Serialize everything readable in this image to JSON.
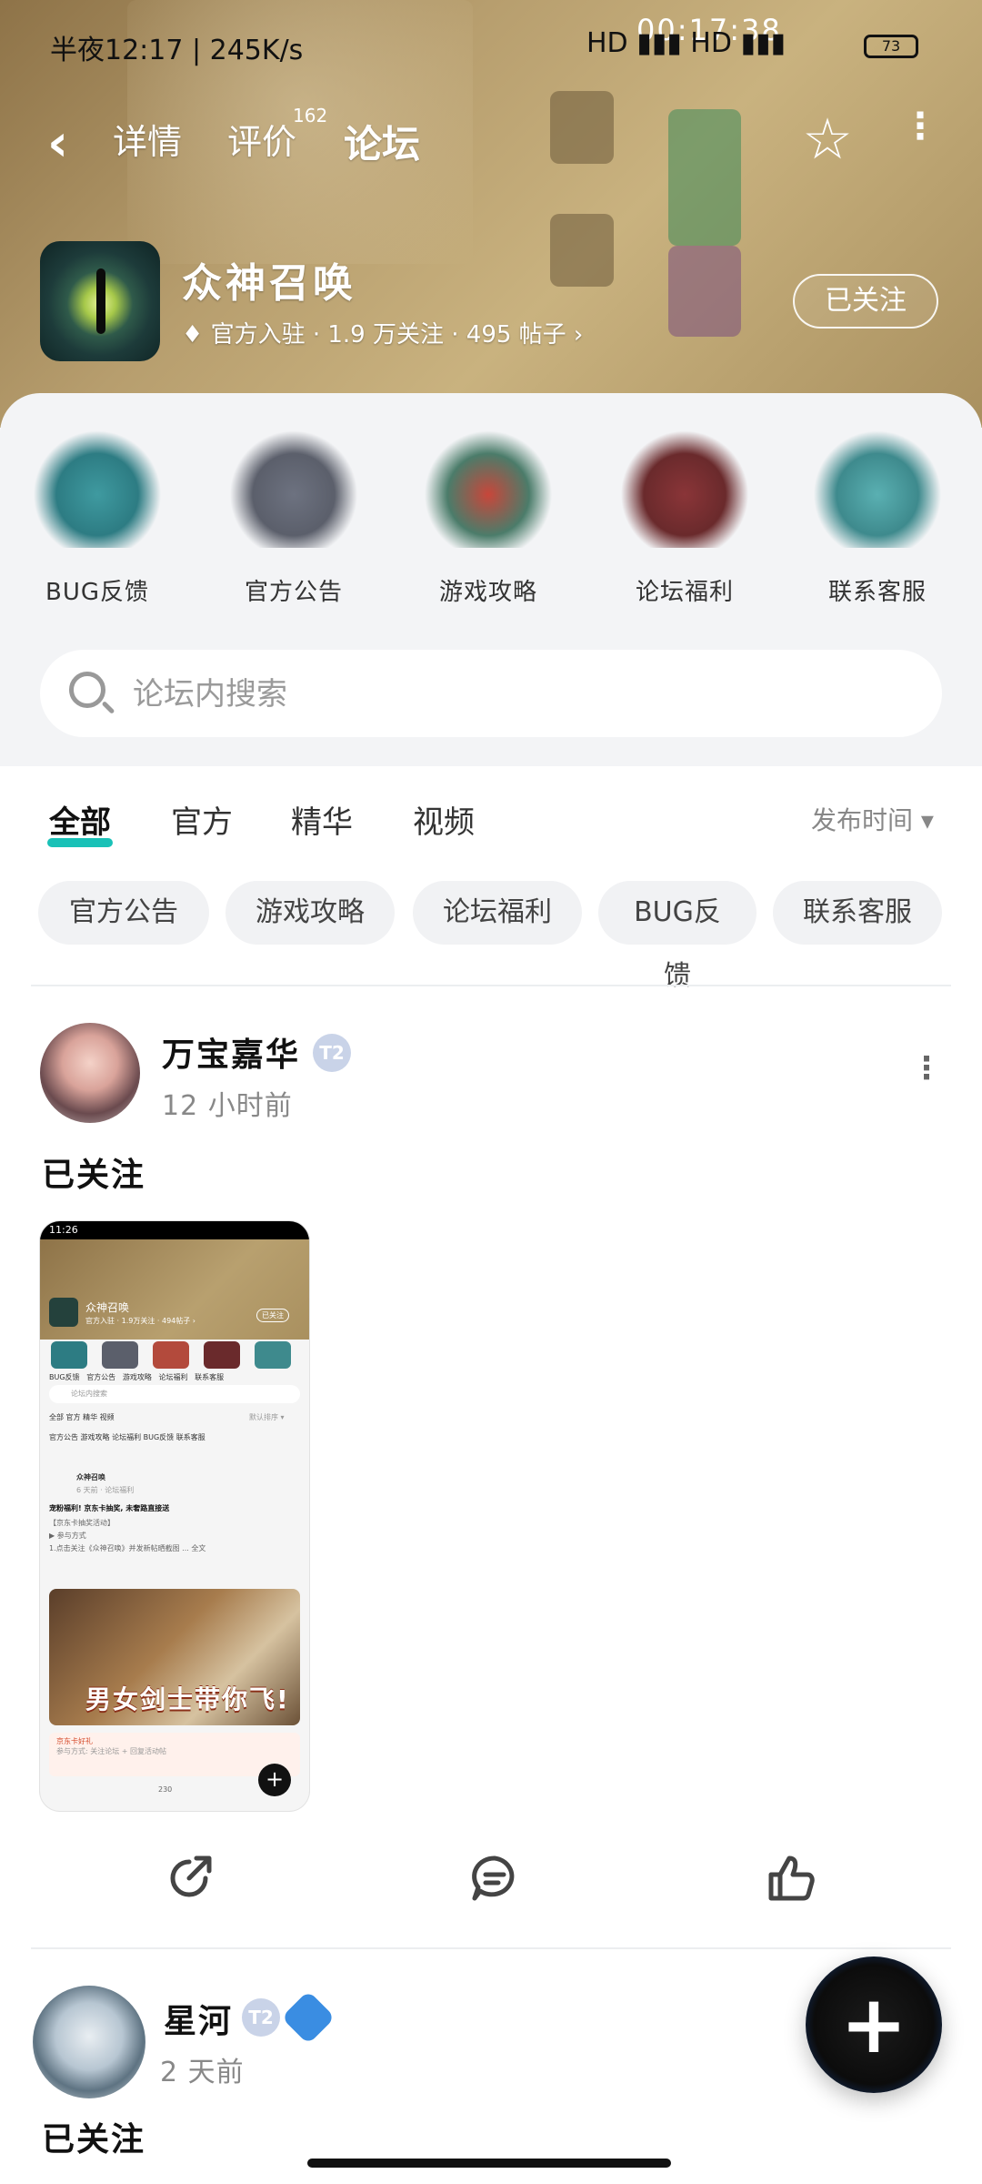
{
  "status_bar": {
    "left_text": "半夜12:17 | 245K/s",
    "time": "00:17:38",
    "network": "HD ▮▮▮ HD ▮▮▮",
    "battery": "73"
  },
  "top_nav": {
    "back_label": "‹",
    "tabs": [
      {
        "label": "详情"
      },
      {
        "label": "评价",
        "badge": "162"
      },
      {
        "label": "论坛"
      }
    ],
    "star_icon": "☆",
    "more_icon": "⋮"
  },
  "app": {
    "title": "众神召唤",
    "subtitle": "官方入驻 · 1.9 万关注 · 495 帖子 ›",
    "follow_label": "已关注"
  },
  "quick_entries": [
    {
      "label": "BUG反馈",
      "color": "#2d7c83"
    },
    {
      "label": "官方公告",
      "color": "#5b5f6b"
    },
    {
      "label": "游戏攻略",
      "color": "#4b7c6a"
    },
    {
      "label": "论坛福利",
      "color": "#6a2a2c"
    },
    {
      "label": "联系客服",
      "color": "#3e8a8d"
    }
  ],
  "search": {
    "placeholder": "论坛内搜索"
  },
  "filter_tabs": [
    "全部",
    "官方",
    "精华",
    "视频"
  ],
  "sort_label": "发布时间 ▾",
  "chips": [
    "官方公告",
    "游戏攻略",
    "论坛福利",
    "BUG反馈",
    "联系客服"
  ],
  "posts": [
    {
      "author": "万宝嘉华",
      "level": "T2",
      "time": "12 小时前",
      "text": "已关注"
    },
    {
      "author": "星河",
      "level": "T2",
      "time": "2 天前",
      "text": "已关注"
    }
  ],
  "screenshot_thumb": {
    "status_time": "11:26",
    "app_title": "众神召唤",
    "app_sub": "官方入驻 · 1.9万关注 · 494帖子 ›",
    "follow": "已关注",
    "quick": [
      "BUG反馈",
      "官方公告",
      "游戏攻略",
      "论坛福利",
      "联系客服"
    ],
    "search": "论坛内搜索",
    "tabs": "全部   官方   精华   视频",
    "sort": "默认排序 ▾",
    "chips": "官方公告   游戏攻略   论坛福利   BUG反馈   联系客服",
    "post_author": "众神召唤",
    "post_meta": "6 天前 · 论坛福利",
    "post_title": "宠粉福利! 京东卡抽奖, 未奢路直接送",
    "post_line1": "【京东卡抽奖活动】",
    "post_line2": "▶ 参与方式",
    "post_line3": "1.点击关注《众神召唤》并发新帖晒截图 ... 全文",
    "banner_text": "男女剑士带你飞!",
    "gift_title": "京东卡好礼",
    "gift_line": "参与方式: 关注论坛 + 回复活动帖",
    "comment_count": "230"
  },
  "actions": {
    "share_icon": "share-icon",
    "comment_icon": "comment-icon",
    "like_icon": "thumbs-up-icon"
  },
  "fab_label": "+"
}
